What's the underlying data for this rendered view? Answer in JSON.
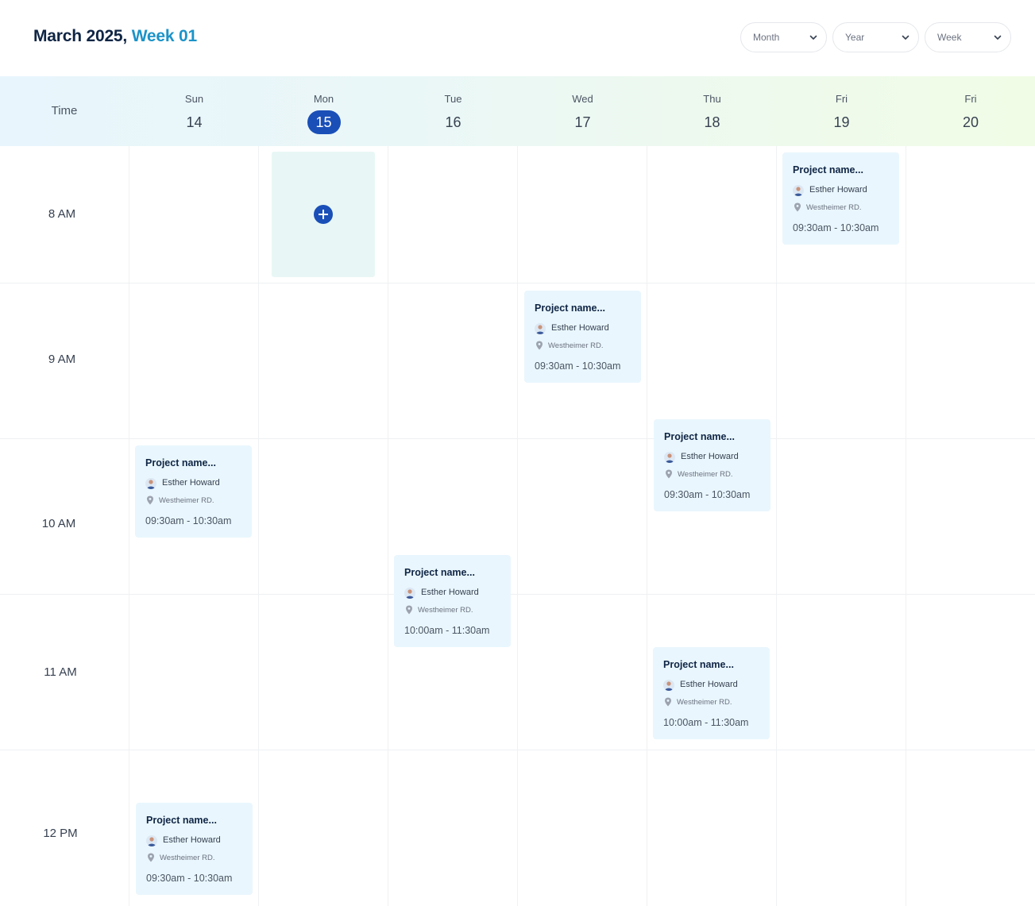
{
  "header": {
    "title": "March 2025,",
    "week": "Week 01",
    "selects": {
      "month": "Month",
      "year": "Year",
      "week": "Week"
    }
  },
  "calendar": {
    "time_label": "Time",
    "today_index": 1,
    "days": [
      {
        "name": "Sun",
        "num": "14"
      },
      {
        "name": "Mon",
        "num": "15"
      },
      {
        "name": "Tue",
        "num": "16"
      },
      {
        "name": "Wed",
        "num": "17"
      },
      {
        "name": "Thu",
        "num": "18"
      },
      {
        "name": "Fri",
        "num": "19"
      },
      {
        "name": "Fri",
        "num": "20"
      }
    ],
    "hours": [
      "8 AM",
      "9 AM",
      "10 AM",
      "11 AM",
      "12 PM"
    ],
    "events": [
      {
        "day": "Fri 19",
        "title": "Project name...",
        "person": "Esther Howard",
        "location": "Westheimer RD.",
        "time": "09:30am - 10:30am"
      },
      {
        "day": "Wed 17",
        "title": "Project name...",
        "person": "Esther Howard",
        "location": "Westheimer RD.",
        "time": "09:30am - 10:30am"
      },
      {
        "day": "Thu 18",
        "title": "Project name...",
        "person": "Esther Howard",
        "location": "Westheimer RD.",
        "time": "09:30am - 10:30am"
      },
      {
        "day": "Sun 14",
        "title": "Project name...",
        "person": "Esther Howard",
        "location": "Westheimer RD.",
        "time": "09:30am - 10:30am"
      },
      {
        "day": "Tue 16",
        "title": "Project name...",
        "person": "Esther Howard",
        "location": "Westheimer RD.",
        "time": "10:00am - 11:30am"
      },
      {
        "day": "Thu 18",
        "title": "Project name...",
        "person": "Esther Howard",
        "location": "Westheimer RD.",
        "time": "10:00am - 11:30am"
      },
      {
        "day": "Sun 14",
        "title": "Project name...",
        "person": "Esther Howard",
        "location": "Westheimer RD.",
        "time": "09:30am - 10:30am"
      }
    ],
    "add_slot_day": "Mon 15"
  },
  "colors": {
    "accent": "#1a4fb8",
    "week_text": "#1c93c8",
    "event_bg": "#e9f6fd",
    "add_slot_bg": "#e8f7f5"
  },
  "icons": {
    "select_chevron": "chevron-down-icon",
    "avatar": "avatar-icon",
    "location": "location-pin-icon",
    "add": "plus-icon"
  }
}
